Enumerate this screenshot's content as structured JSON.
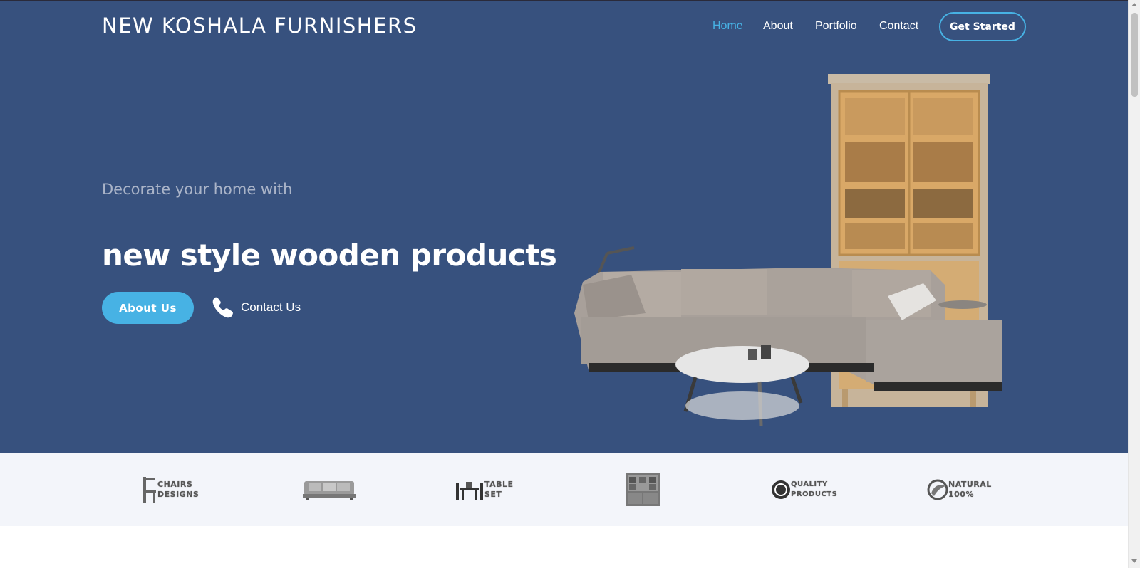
{
  "header": {
    "logo": "NEW KOSHALA FURNISHERS",
    "nav": [
      {
        "label": "Home",
        "active": true
      },
      {
        "label": "About",
        "active": false
      },
      {
        "label": "Portfolio",
        "active": false
      },
      {
        "label": "Contact",
        "active": false
      }
    ],
    "cta_label": "Get Started"
  },
  "hero": {
    "subtitle": "Decorate your home with",
    "title": "new style wooden products",
    "about_button": "About Us",
    "contact_button": "Contact Us",
    "contact_icon": "phone-icon",
    "image": "sofa-and-cabinet-illustration"
  },
  "clients": [
    {
      "name": "chairs-designs-logo",
      "lines": [
        "CHAIRS",
        "DESIGNS"
      ]
    },
    {
      "name": "sofa-logo",
      "lines": []
    },
    {
      "name": "table-set-logo",
      "lines": [
        "TABLE",
        "SET"
      ]
    },
    {
      "name": "cabinet-logo",
      "lines": []
    },
    {
      "name": "quality-products-logo",
      "lines": [
        "QUALITY",
        "PRODUCTS"
      ]
    },
    {
      "name": "natural-logo",
      "lines": [
        "NATURAL",
        "100%"
      ]
    }
  ],
  "colors": {
    "hero_bg": "#37517e",
    "accent": "#47b2e4",
    "clients_bg": "#f3f5fa"
  }
}
